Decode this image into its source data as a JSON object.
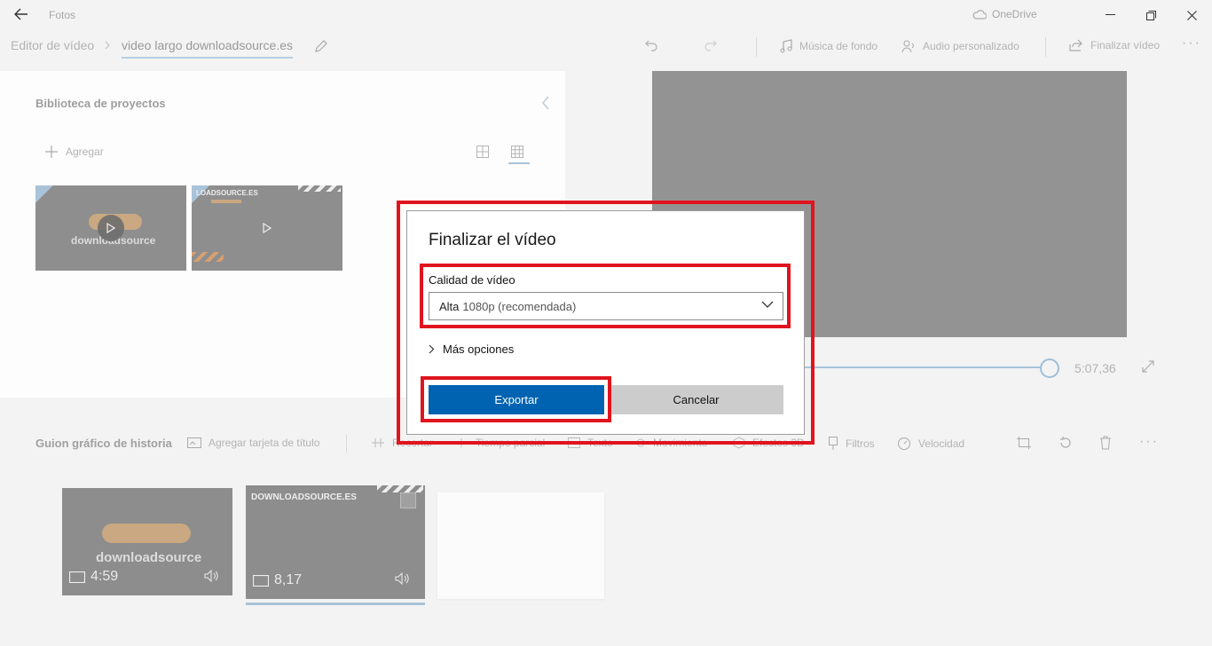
{
  "window": {
    "app_title": "Fotos",
    "onedrive_label": "OneDrive"
  },
  "breadcrumb": {
    "parent": "Editor de vídeo",
    "current": "video largo downloadsource.es"
  },
  "toolbar": {
    "background_music": "Música de fondo",
    "custom_audio": "Audio personalizado",
    "finish_video": "Finalizar vídeo"
  },
  "library": {
    "title": "Biblioteca de proyectos",
    "add_label": "Agregar",
    "thumbnails": [
      {
        "brand_text": "downloadsource"
      },
      {
        "brand_text": "LOADSOURCE.ES"
      }
    ]
  },
  "preview": {
    "duration": "5:07,36",
    "progress": 1.0
  },
  "storyboard": {
    "title": "Guion gráfico de historia",
    "add_title_card": "Agregar tarjeta de título",
    "tools": [
      "Recortar",
      "Tiempo parcial",
      "Texto",
      "Movimiento",
      "Efectos 3D",
      "Filtros",
      "Velocidad"
    ],
    "clips": [
      {
        "duration": "4:59",
        "brand_text": "downloadsource"
      },
      {
        "duration": "8,17",
        "brand_text": "DOWNLOADSOURCE.ES"
      }
    ]
  },
  "dialog": {
    "title": "Finalizar el vídeo",
    "quality_label": "Calidad de vídeo",
    "quality_value_main": "Alta",
    "quality_value_detail": "1080p (recomendada)",
    "more_options": "Más opciones",
    "export_button": "Exportar",
    "cancel_button": "Cancelar"
  },
  "colors": {
    "accent": "#0063b1",
    "highlight": "#e0141e",
    "overlay_gray": "#939393"
  }
}
